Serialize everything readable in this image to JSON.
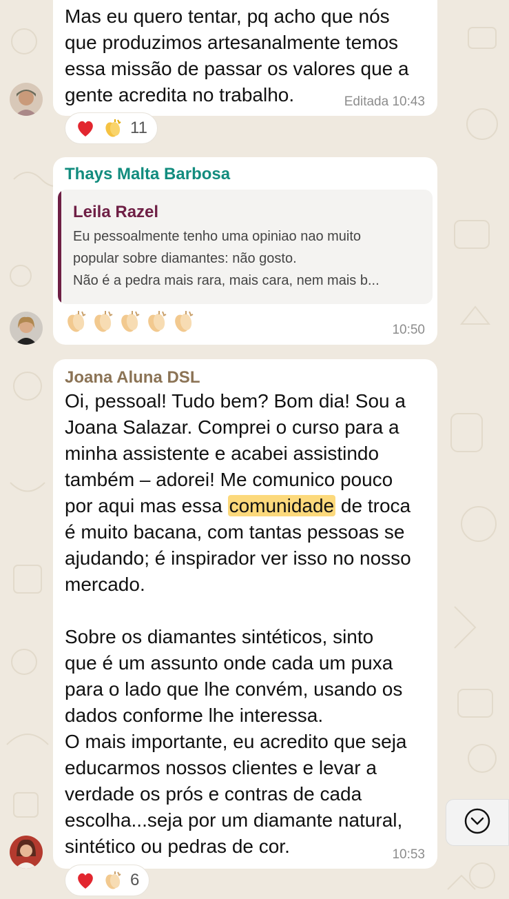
{
  "messages": [
    {
      "text": "Mas eu quero tentar, pq acho que nós\nque produzimos artesanalmente temos\nessa missão de passar os valores que a\ngente acredita no trabalho.",
      "meta": "Editada 10:43",
      "reactions": [
        "heart-emoji",
        "clapping-hands-emoji"
      ],
      "reaction_count": "11"
    },
    {
      "sender": "Thays Malta Barbosa",
      "sender_color": "#128c7e",
      "quote": {
        "author": "Leila Razel",
        "author_color": "#6e1f45",
        "lines": [
          "Eu pessoalmente tenho uma opiniao nao muito",
          "popular sobre diamantes: não gosto.",
          "Não é a pedra mais rara, mais cara, nem mais b..."
        ]
      },
      "emoji_row": [
        "clapping-hands-emoji",
        "clapping-hands-emoji",
        "clapping-hands-emoji",
        "clapping-hands-emoji",
        "clapping-hands-emoji"
      ],
      "time": "10:50"
    },
    {
      "sender": "Joana Aluna DSL",
      "sender_color": "#8b7355",
      "text_before_highlight": "Oi, pessoal! Tudo bem? Bom dia! Sou a\nJoana Salazar. Comprei o curso para a\nminha assistente e acabei assistindo\ntambém – adorei! Me comunico pouco\npor aqui mas essa ",
      "highlight": "comunidade",
      "text_after_highlight": " de troca\né muito bacana, com tantas pessoas se\najudando; é inspirador ver isso no nosso\nmercado.\n\nSobre os diamantes sintéticos, sinto\nque é um assunto onde cada um puxa\npara o lado que lhe convém, usando os\ndados conforme lhe interessa.\nO mais importante, eu acredito que seja\neducarmos nossos clientes e levar a\nverdade os prós e contras de cada\nescolha...seja por um diamante natural,\nsintético ou pedras de cor.",
      "time": "10:53",
      "reactions": [
        "heart-emoji",
        "clapping-hands-emoji"
      ],
      "reaction_count": "6"
    }
  ],
  "colors": {
    "highlight": "#fcd97c",
    "heart": "#e2262f",
    "clap": "#f2c98f"
  },
  "scroll_button_icon": "chevron-down-icon"
}
